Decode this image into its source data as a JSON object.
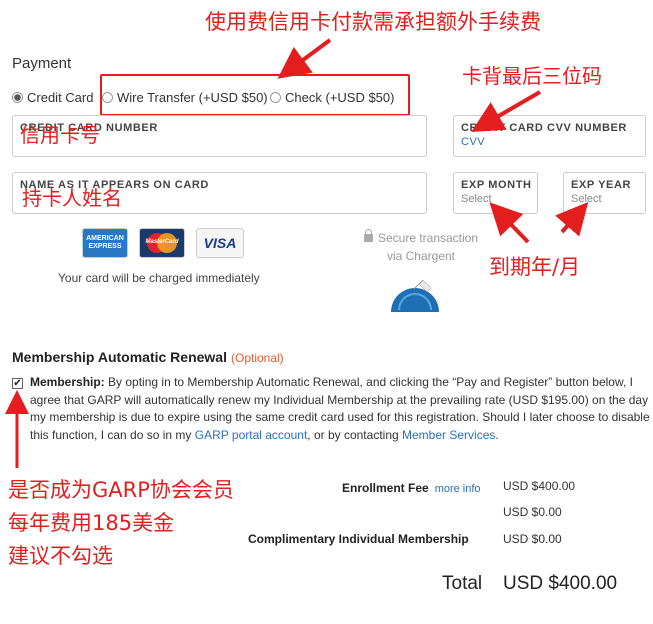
{
  "payment": {
    "title": "Payment",
    "methods": [
      {
        "label": "Credit Card",
        "selected": true
      },
      {
        "label": "Wire Transfer (+USD $50)",
        "selected": false
      },
      {
        "label": "Check (+USD $50)",
        "selected": false
      }
    ],
    "fields": {
      "card_number": {
        "label": "CREDIT CARD NUMBER"
      },
      "cvv": {
        "label": "CREDIT CARD CVV NUMBER",
        "placeholder": "CVV"
      },
      "name": {
        "label": "NAME AS IT APPEARS ON CARD"
      },
      "exp_month": {
        "label": "EXP MONTH",
        "value": "Select"
      },
      "exp_year": {
        "label": "EXP YEAR",
        "value": "Select"
      }
    },
    "card_logos": {
      "amex": "AMERICAN EXPRESS",
      "mastercard": "MasterCard",
      "visa": "VISA"
    },
    "charged_note": "Your card will be charged immediately",
    "secure_line1": "Secure transaction",
    "secure_line2": "via Chargent"
  },
  "membership": {
    "title": "Membership Automatic Renewal",
    "optional": "(Optional)",
    "checked": true,
    "bold_lead": "Membership:",
    "text_part1": "By opting in to Membership Automatic Renewal, and clicking the “Pay and Register” button below, I agree that GARP will automatically renew my Individual Membership at the prevailing rate (USD $195.00) on the day my membership is due to expire using the same credit card used for this registration. Should I later choose to disable this function, I can do so in my",
    "link1": "GARP portal account",
    "text_part2": ", or by contacting",
    "link2": "Member Services",
    "text_end": "."
  },
  "fees": {
    "enrollment_label": "Enrollment Fee",
    "more_info": "more info",
    "enrollment_value": "USD $400.00",
    "blank_value": "USD $0.00",
    "complimentary_label": "Complimentary Individual Membership",
    "complimentary_value": "USD $0.00",
    "total_label": "Total",
    "total_value": "USD $400.00"
  },
  "annotations": {
    "top_note": "使用费信用卡付款需承担额外手续费",
    "cvv_note": "卡背最后三位码",
    "card_number_note": "信用卡号",
    "name_note": "持卡人姓名",
    "expiry_note": "到期年/月",
    "membership_note_1": "是否成为GARP协会会员",
    "membership_note_2": "每年费用185美金",
    "membership_note_3": "建议不勾选",
    "color": "#e41e1e"
  }
}
